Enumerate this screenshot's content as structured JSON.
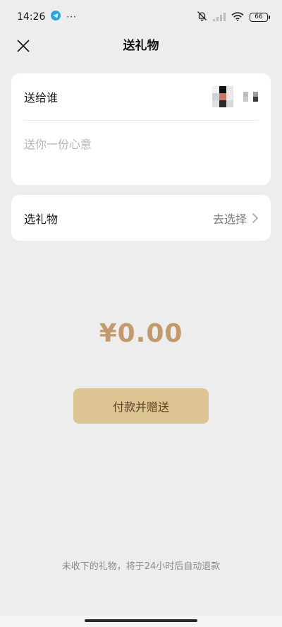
{
  "status_bar": {
    "time": "14:26",
    "more": "···",
    "battery": "66"
  },
  "header": {
    "title": "送礼物"
  },
  "recipient": {
    "label": "送给谁",
    "message_placeholder": "送你一份心意"
  },
  "gift": {
    "label": "选礼物",
    "action": "去选择"
  },
  "amount": "¥0.00",
  "pay_button": {
    "label": "付款并赠送"
  },
  "footer_note": "未收下的礼物，将于24小时后自动退款",
  "colors": {
    "background": "#ededed",
    "amount": "#c29a6b",
    "button": "#dcc592",
    "button_text": "#5a4628"
  }
}
